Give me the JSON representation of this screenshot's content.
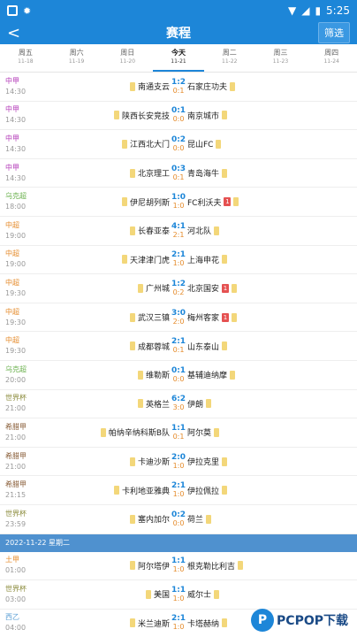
{
  "status": {
    "left_icon": "notification-square",
    "bug_icon": "bug-icon",
    "time": "5:25"
  },
  "header": {
    "back": "<",
    "title": "赛程",
    "filter": "筛选"
  },
  "days": [
    {
      "name": "周五",
      "date": "11-18"
    },
    {
      "name": "周六",
      "date": "11-19"
    },
    {
      "name": "周日",
      "date": "11-20"
    },
    {
      "name": "今天",
      "date": "11-21",
      "active": true
    },
    {
      "name": "周二",
      "date": "11-22"
    },
    {
      "name": "周三",
      "date": "11-23"
    },
    {
      "name": "周四",
      "date": "11-24"
    }
  ],
  "colors": {
    "csl": "#b33ab8",
    "uzb": "#6ab04c",
    "cl1": "#e58b2b",
    "wc": "#8a8a3a",
    "gre": "#8a5f3a",
    "esp": "#5ea0d6"
  },
  "matches": [
    {
      "league": "中甲",
      "lc": "#b33ab8",
      "time": "14:30",
      "home": "南通支云",
      "away": "石家庄功夫",
      "ft": "1:2",
      "ht": "0:1"
    },
    {
      "league": "中甲",
      "lc": "#b33ab8",
      "time": "14:30",
      "home": "陕西长安竞技",
      "away": "南京城市",
      "ft": "0:1",
      "ht": "0:0"
    },
    {
      "league": "中甲",
      "lc": "#b33ab8",
      "time": "14:30",
      "home": "江西北大门",
      "away": "昆山FC",
      "ft": "0:2",
      "ht": "0:0"
    },
    {
      "league": "中甲",
      "lc": "#b33ab8",
      "time": "14:30",
      "home": "北京理工",
      "away": "青岛海牛",
      "ft": "0:3",
      "ht": "0:1"
    },
    {
      "league": "乌克超",
      "lc": "#6ab04c",
      "time": "18:00",
      "home": "伊尼胡列斯",
      "away": "FC利沃夫",
      "ft": "1:0",
      "ht": "1:0",
      "away_red": "1"
    },
    {
      "league": "中超",
      "lc": "#e58b2b",
      "time": "19:00",
      "home": "长春亚泰",
      "away": "河北队",
      "ft": "4:1",
      "ht": "2:1"
    },
    {
      "league": "中超",
      "lc": "#e58b2b",
      "time": "19:00",
      "home": "天津津门虎",
      "away": "上海申花",
      "ft": "2:1",
      "ht": "1:0"
    },
    {
      "league": "中超",
      "lc": "#e58b2b",
      "time": "19:30",
      "home": "广州城",
      "away": "北京国安",
      "ft": "1:2",
      "ht": "0:2",
      "away_red": "1"
    },
    {
      "league": "中超",
      "lc": "#e58b2b",
      "time": "19:30",
      "home": "武汉三镇",
      "away": "梅州客家",
      "ft": "3:0",
      "ht": "2:0",
      "away_red": "1"
    },
    {
      "league": "中超",
      "lc": "#e58b2b",
      "time": "19:30",
      "home": "成都蓉城",
      "away": "山东泰山",
      "ft": "2:1",
      "ht": "0:1"
    },
    {
      "league": "乌克超",
      "lc": "#6ab04c",
      "time": "20:00",
      "home": "维勒斯",
      "away": "基辅迪纳摩",
      "ft": "0:1",
      "ht": "0:0"
    },
    {
      "league": "世界杯",
      "lc": "#8a8a3a",
      "time": "21:00",
      "home": "英格兰",
      "away": "伊朗",
      "ft": "6:2",
      "ht": "3:0"
    },
    {
      "league": "希腊甲",
      "lc": "#8a5f3a",
      "time": "21:00",
      "home": "帕纳辛纳科斯B队",
      "away": "阿尔莫",
      "ft": "1:1",
      "ht": "0:1"
    },
    {
      "league": "希腊甲",
      "lc": "#8a5f3a",
      "time": "21:00",
      "home": "卡迪沙斯",
      "away": "伊拉克里",
      "ft": "2:0",
      "ht": "1:0"
    },
    {
      "league": "希腊甲",
      "lc": "#8a5f3a",
      "time": "21:15",
      "home": "卡利地亚雅典",
      "away": "伊拉佩拉",
      "ft": "2:1",
      "ht": "1:0"
    },
    {
      "league": "世界杯",
      "lc": "#8a8a3a",
      "time": "23:59",
      "home": "塞内加尔",
      "away": "荷兰",
      "ft": "0:2",
      "ht": "0:0"
    }
  ],
  "separator": "2022-11-22 星期二",
  "matches2": [
    {
      "league": "土甲",
      "lc": "#e58b2b",
      "time": "01:00",
      "home": "阿尔塔伊",
      "away": "根克勒比利吉",
      "ft": "1:1",
      "ht": "1:0"
    },
    {
      "league": "世界杯",
      "lc": "#8a8a3a",
      "time": "03:00",
      "home": "美国",
      "away": "威尔士",
      "ft": "1:1",
      "ht": "1:0"
    },
    {
      "league": "西乙",
      "lc": "#5ea0d6",
      "time": "04:00",
      "home": "米兰迪斯",
      "away": "卡塔赫纳",
      "ft": "2:1",
      "ht": "1:0"
    }
  ],
  "watermark": {
    "logo": "P",
    "text": "PCPOP下载"
  }
}
